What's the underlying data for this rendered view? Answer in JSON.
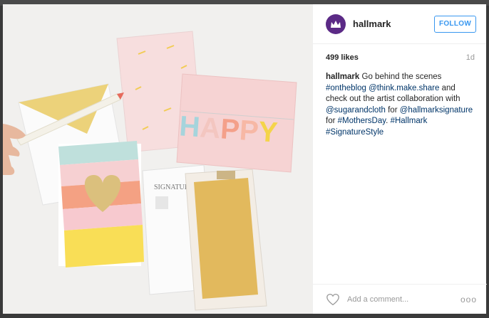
{
  "post": {
    "username": "hallmark",
    "follow_label": "FOLLOW",
    "likes": "499 likes",
    "age": "1d",
    "caption": [
      {
        "t": "hallmark",
        "k": "u"
      },
      {
        "t": " Go behind the scenes ",
        "k": ""
      },
      {
        "t": "#ontheblog",
        "k": "tag"
      },
      {
        "t": " ",
        "k": ""
      },
      {
        "t": "@think.make.share",
        "k": "tag"
      },
      {
        "t": " and check out the artist collaboration with ",
        "k": ""
      },
      {
        "t": "@sugarandcloth",
        "k": "tag"
      },
      {
        "t": " for ",
        "k": ""
      },
      {
        "t": "@hallmarksignature",
        "k": "tag"
      },
      {
        "t": " for ",
        "k": ""
      },
      {
        "t": "#MothersDay",
        "k": "tag"
      },
      {
        "t": ". ",
        "k": ""
      },
      {
        "t": "#Hallmark",
        "k": "tag"
      },
      {
        "t": " ",
        "k": ""
      },
      {
        "t": "#SignatureStyle",
        "k": "tag"
      }
    ],
    "comment_placeholder": "Add a comment...",
    "more_glyph": "ooo"
  },
  "photo": {
    "happy_word": "HAPPY",
    "signature_word": "SIGNATURE"
  },
  "colors": {
    "link": "#003569",
    "follow": "#3897f0",
    "avatar": "#5b2a86"
  },
  "icons": {
    "avatar": "crown-icon",
    "like": "heart-icon",
    "more": "more-dots-icon"
  }
}
